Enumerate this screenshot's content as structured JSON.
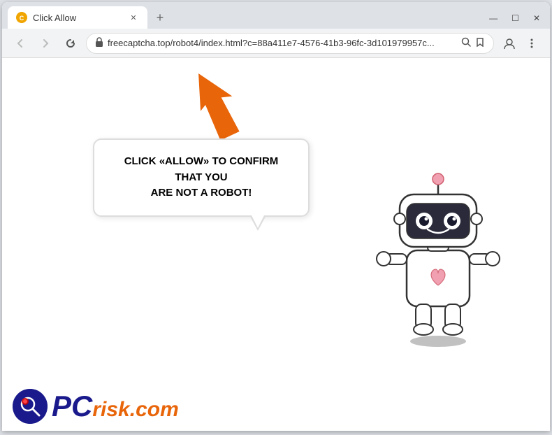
{
  "browser": {
    "tab": {
      "title": "Click Allow",
      "favicon": "C"
    },
    "address": "freecaptcha.top/robot4/index.html?c=88a411e7-4576-41b3-96fc-3d101979957c...",
    "new_tab_label": "+",
    "window_controls": {
      "minimize": "—",
      "maximize": "☐",
      "close": "✕"
    }
  },
  "page": {
    "bubble_text_line1": "CLICK «ALLOW» TO CONFIRM THAT YOU",
    "bubble_text_line2": "ARE NOT A ROBOT!",
    "bubble_text_full": "CLICK «ALLOW» TO CONFIRM THAT YOU ARE NOT A ROBOT!"
  },
  "logo": {
    "brand_main": "PC",
    "brand_sub": "risk.com"
  },
  "nav": {
    "back": "←",
    "forward": "→",
    "reload": "✕",
    "lock": "🔒"
  }
}
